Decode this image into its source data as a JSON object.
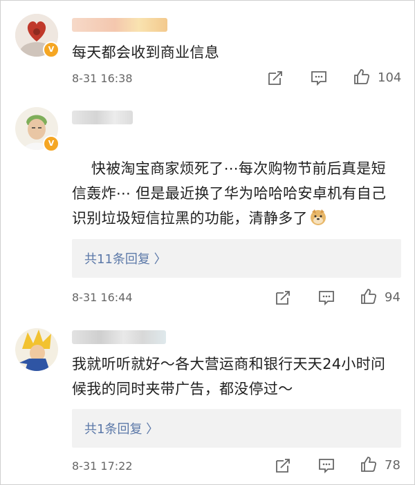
{
  "comments": [
    {
      "text": "每天都会收到商业信息",
      "time": "8-31 16:38",
      "likes": "104",
      "verified": "V"
    },
    {
      "text": "快被淘宝商家烦死了⋯每次购物节前后真是短信轰炸⋯ 但是最近换了华为哈哈哈安卓机有自己识别垃圾短信拉黑的功能，清静多了",
      "time": "8-31 16:44",
      "likes": "94",
      "replies": "共11条回复 〉",
      "verified": "V"
    },
    {
      "text": "我就听听就好～各大营运商和银行天天24小时问候我的同时夹带广告，都没停过～",
      "time": "8-31 17:22",
      "likes": "78",
      "replies": "共1条回复 〉"
    }
  ],
  "colors": {
    "link": "#5b78a8",
    "meta": "#666666",
    "reply_bg": "#f2f2f2",
    "badge": "#f5a623"
  },
  "icons": [
    "share-icon",
    "comment-icon",
    "like-icon",
    "doge-emoji"
  ]
}
